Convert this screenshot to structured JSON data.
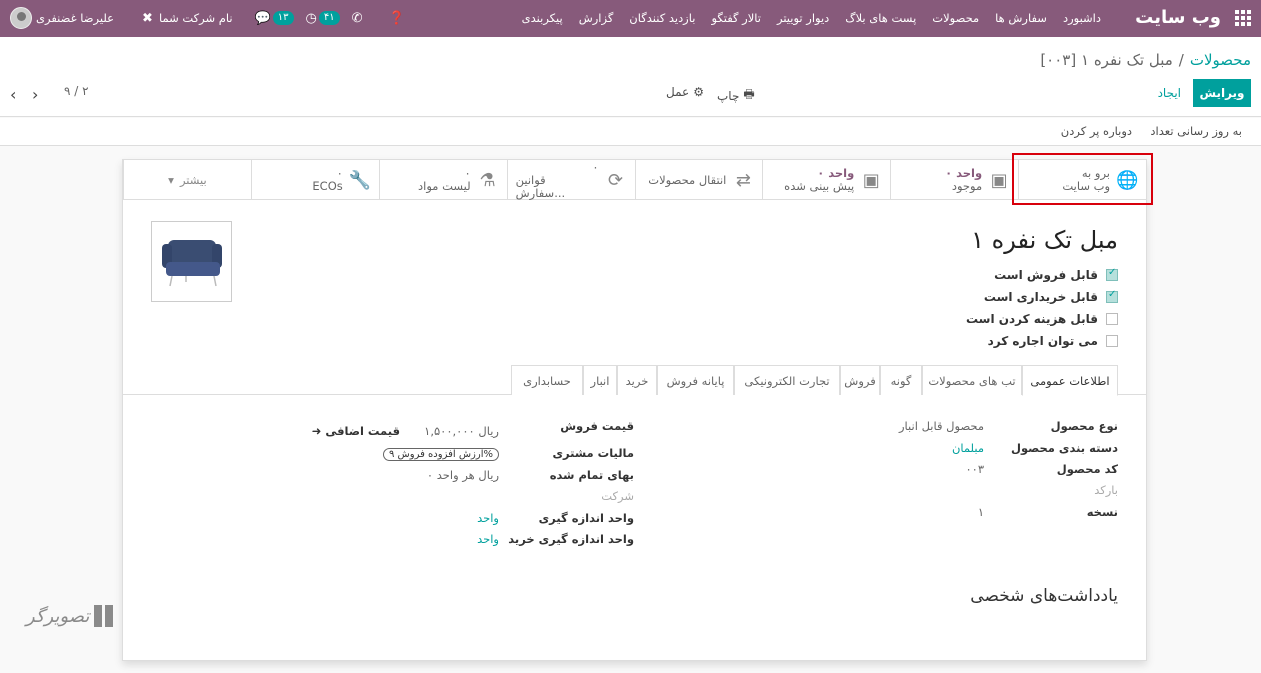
{
  "topbar": {
    "brand": "وب سایت",
    "menu": [
      "داشبورد",
      "سفارش ها",
      "محصولات",
      "پست های بلاگ",
      "دیوار توییتر",
      "تالار گفتگو",
      "بازدید کنندگان",
      "گزارش",
      "پیکربندی"
    ],
    "user": "علیرضا غضنفری",
    "company": "نام شرکت شما",
    "badge_messages": "۱۳",
    "badge_activities": "۴۱"
  },
  "breadcrumb": {
    "parent": "محصولات",
    "separator": "/",
    "current": "[۰۰۳] مبل تک نفره ۱"
  },
  "actions": {
    "edit": "ویرایش",
    "create": "ایجاد",
    "print": "چاپ",
    "action": "عمل",
    "pager": "۹ / ۲"
  },
  "statusbar": {
    "update_qty": "به روز رسانی تعداد",
    "replenish": "دوباره پر کردن"
  },
  "smart_buttons": {
    "goto": {
      "l1": "برو به",
      "l2": "وب سایت"
    },
    "onhand": {
      "value": "۰ واحد",
      "label": "موجود"
    },
    "forecast": {
      "value": "۰ واحد",
      "label": "پیش بینی شده"
    },
    "moves": {
      "label": "انتقال محصولات"
    },
    "rules": {
      "value": "۰",
      "label": "قوانین سفارش..."
    },
    "bom": {
      "value": "۰",
      "label": "لیست مواد"
    },
    "ecos": {
      "value": "۰",
      "label": "ECOs"
    },
    "more": "بیشتر"
  },
  "product": {
    "name": "مبل تک نفره ۱",
    "checks": [
      {
        "label": "قابل فروش است",
        "checked": true
      },
      {
        "label": "قابل خریداری است",
        "checked": true
      },
      {
        "label": "قابل هزینه کردن است",
        "checked": false
      },
      {
        "label": "می توان اجاره کرد",
        "checked": false
      }
    ]
  },
  "tabs": [
    "اطلاعات عمومی",
    "تب های محصولات",
    "گونه",
    "فروش",
    "تجارت الکترونیکی",
    "پایانه فروش",
    "خرید",
    "انبار",
    "حسابداری"
  ],
  "general": {
    "type_label": "نوع محصول",
    "type_value": "محصول قابل انبار",
    "category_label": "دسته بندی محصول",
    "category_value": "مبلمان",
    "code_label": "کد محصول",
    "code_value": "۰۰۳",
    "barcode_label": "بارکد",
    "version_label": "نسخه",
    "version_value": "۱",
    "price_label": "قیمت فروش",
    "price_value": "۱,۵۰۰,۰۰۰ ریال",
    "extra_price": "قیمت اضافی",
    "tax_label": "مالیات مشتری",
    "tax_value": "ارزش افزوده فروش ۹%",
    "cost_label": "بهای تمام شده",
    "cost_value": "۰ ریال هر واحد",
    "company_placeholder": "شرکت",
    "uom_label": "واحد اندازه گیری",
    "uom_value": "واحد",
    "po_uom_label": "واحد اندازه گیری خرید",
    "po_uom_value": "واحد"
  },
  "notes_title": "یادداشت‌های شخصی",
  "watermark": "تصویرگر"
}
